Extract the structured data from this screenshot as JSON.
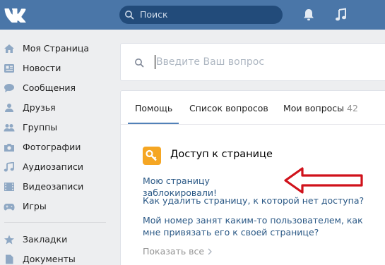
{
  "header": {
    "search_placeholder": "Поиск"
  },
  "sidebar": {
    "items": [
      {
        "label": "Моя Страница",
        "icon": "home-icon"
      },
      {
        "label": "Новости",
        "icon": "news-icon"
      },
      {
        "label": "Сообщения",
        "icon": "messages-icon"
      },
      {
        "label": "Друзья",
        "icon": "friend-icon"
      },
      {
        "label": "Группы",
        "icon": "groups-icon"
      },
      {
        "label": "Фотографии",
        "icon": "camera-icon"
      },
      {
        "label": "Аудиозаписи",
        "icon": "music-note-icon"
      },
      {
        "label": "Видеозаписи",
        "icon": "film-icon"
      },
      {
        "label": "Игры",
        "icon": "gamepad-icon"
      }
    ],
    "items2": [
      {
        "label": "Закладки",
        "icon": "star-icon"
      },
      {
        "label": "Документы",
        "icon": "document-icon"
      }
    ]
  },
  "question": {
    "placeholder": "Введите Ваш вопрос"
  },
  "tabs": [
    {
      "label": "Помощь"
    },
    {
      "label": "Список вопросов"
    },
    {
      "label": "Мои вопросы",
      "count": "42"
    }
  ],
  "section": {
    "title": "Доступ к странице",
    "icon": "key-icon",
    "links": [
      "Мою страницу заблокировали!",
      "Как удалить страницу, к которой нет доступа?",
      "Мой номер занят каким-то пользователем, как мне привязать его к своей странице?"
    ],
    "more_label": "Показать все"
  },
  "colors": {
    "header": "#4a76a8",
    "link": "#2a5885",
    "arrow": "#d0121b",
    "key_badge": "#f5a623"
  }
}
